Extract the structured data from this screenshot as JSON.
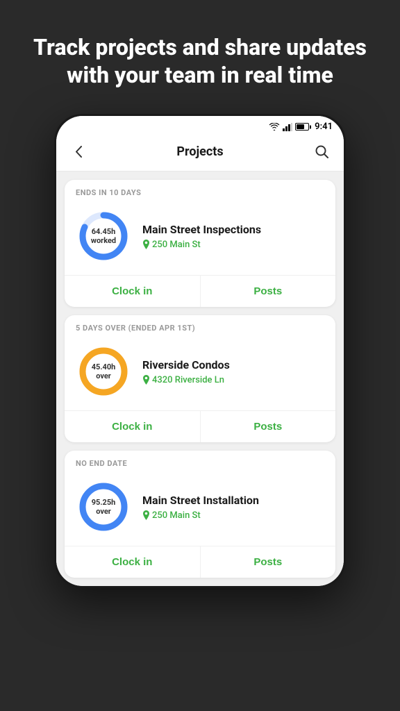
{
  "page": {
    "background_color": "#2a2a2a",
    "hero_text": "Track projects and share updates with your team in real time"
  },
  "status_bar": {
    "time": "9:41"
  },
  "nav": {
    "title": "Projects",
    "back_icon": "←",
    "search_icon": "🔍"
  },
  "projects": [
    {
      "id": "project-1",
      "header_label": "ENDS IN 10 DAYS",
      "name": "Main Street Inspections",
      "address": "250 Main St",
      "donut_center_line1": "64.45h",
      "donut_center_line2": "worked",
      "donut_color": "#4285f4",
      "donut_track_color": "#dde8fd",
      "donut_percent": 82,
      "clock_in_label": "Clock in",
      "posts_label": "Posts"
    },
    {
      "id": "project-2",
      "header_label": "5 DAYS OVER (ENDED APR 1ST)",
      "name": "Riverside Condos",
      "address": "4320 Riverside Ln",
      "donut_center_line1": "45.40h",
      "donut_center_line2": "over",
      "donut_color": "#f5a623",
      "donut_track_color": "#fde8cc",
      "donut_percent": 100,
      "clock_in_label": "Clock in",
      "posts_label": "Posts"
    },
    {
      "id": "project-3",
      "header_label": "NO END DATE",
      "name": "Main Street Installation",
      "address": "250 Main St",
      "donut_center_line1": "95.25h",
      "donut_center_line2": "over",
      "donut_color": "#4285f4",
      "donut_track_color": "#dde8fd",
      "donut_percent": 100,
      "clock_in_label": "Clock in",
      "posts_label": "Posts"
    }
  ]
}
